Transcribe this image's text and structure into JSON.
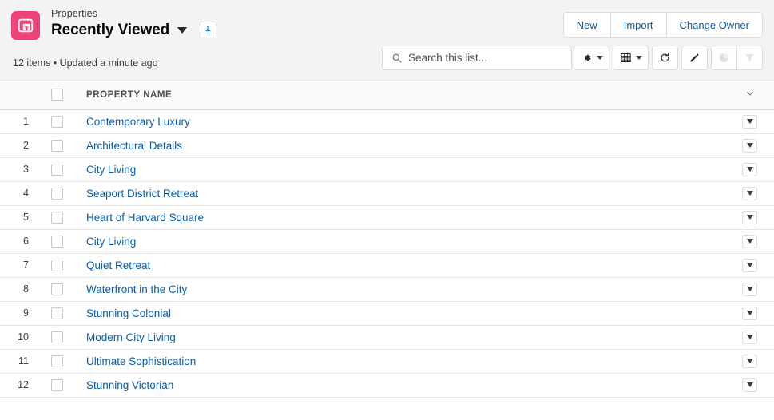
{
  "header": {
    "object_name": "Properties",
    "list_view_title": "Recently Viewed",
    "list_view_caret": "chevron-down-icon",
    "pin_icon": "pin-icon",
    "app_icon": "property-icon",
    "brand_color": "#ec4476",
    "link_color": "#0b5cab",
    "meta_text": "12 items • Updated a minute ago",
    "actions": [
      {
        "label": "New",
        "name": "new-button"
      },
      {
        "label": "Import",
        "name": "import-button"
      },
      {
        "label": "Change Owner",
        "name": "change-owner-button"
      }
    ]
  },
  "search": {
    "placeholder": "Search this list...",
    "value": "",
    "icon": "search-icon"
  },
  "toolbar": [
    {
      "name": "list-view-controls-button",
      "icon": "gear-icon",
      "caret": true,
      "disabled": false
    },
    {
      "name": "display-as-button",
      "icon": "table-icon",
      "caret": true,
      "disabled": false
    },
    {
      "name": "refresh-button",
      "icon": "refresh-icon",
      "caret": false,
      "disabled": false
    },
    {
      "name": "edit-button",
      "icon": "pencil-icon",
      "caret": false,
      "disabled": false
    },
    {
      "name": "charts-button",
      "icon": "chart-icon",
      "caret": false,
      "disabled": true
    },
    {
      "name": "filter-button",
      "icon": "filter-icon",
      "caret": false,
      "disabled": true
    }
  ],
  "table": {
    "select_all_checkbox": "select-all-checkbox",
    "column_header": "PROPERTY NAME",
    "column_actions_icon": "chevron-down-icon",
    "rows": [
      {
        "num": "1",
        "name": "Contemporary Luxury"
      },
      {
        "num": "2",
        "name": "Architectural Details"
      },
      {
        "num": "3",
        "name": "City Living"
      },
      {
        "num": "4",
        "name": "Seaport District Retreat"
      },
      {
        "num": "5",
        "name": "Heart of Harvard Square"
      },
      {
        "num": "6",
        "name": "City Living"
      },
      {
        "num": "7",
        "name": "Quiet Retreat"
      },
      {
        "num": "8",
        "name": "Waterfront in the City"
      },
      {
        "num": "9",
        "name": "Stunning Colonial"
      },
      {
        "num": "10",
        "name": "Modern City Living"
      },
      {
        "num": "11",
        "name": "Ultimate Sophistication"
      },
      {
        "num": "12",
        "name": "Stunning Victorian"
      }
    ]
  }
}
